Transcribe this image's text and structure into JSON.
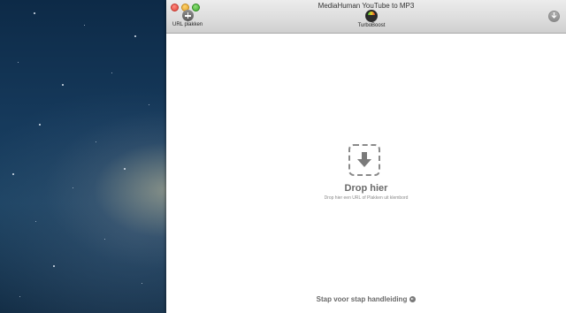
{
  "window": {
    "title": "MediaHuman YouTube to MP3"
  },
  "toolbar": {
    "paste_label": "URL plakken",
    "turbo_label": "TurboBoost",
    "paste_icon": "plus-circle-icon",
    "turbo_icon": "speedometer-icon",
    "download_icon": "download-arrow-icon"
  },
  "dropzone": {
    "icon": "download-arrow-icon",
    "title": "Drop hier",
    "subtitle": "Drop hier een URL of Plakken uit klembord"
  },
  "footer": {
    "guide_label": "Stap voor stap handleiding",
    "guide_icon": "arrow-right-circle-icon"
  },
  "colors": {
    "window_bg": "#ffffff",
    "titlebar_bg": "#dcdcdc",
    "text_muted": "#6a6a6a",
    "close": "#e0443a",
    "minimize": "#e1a22a",
    "maximize": "#3faa2e"
  }
}
